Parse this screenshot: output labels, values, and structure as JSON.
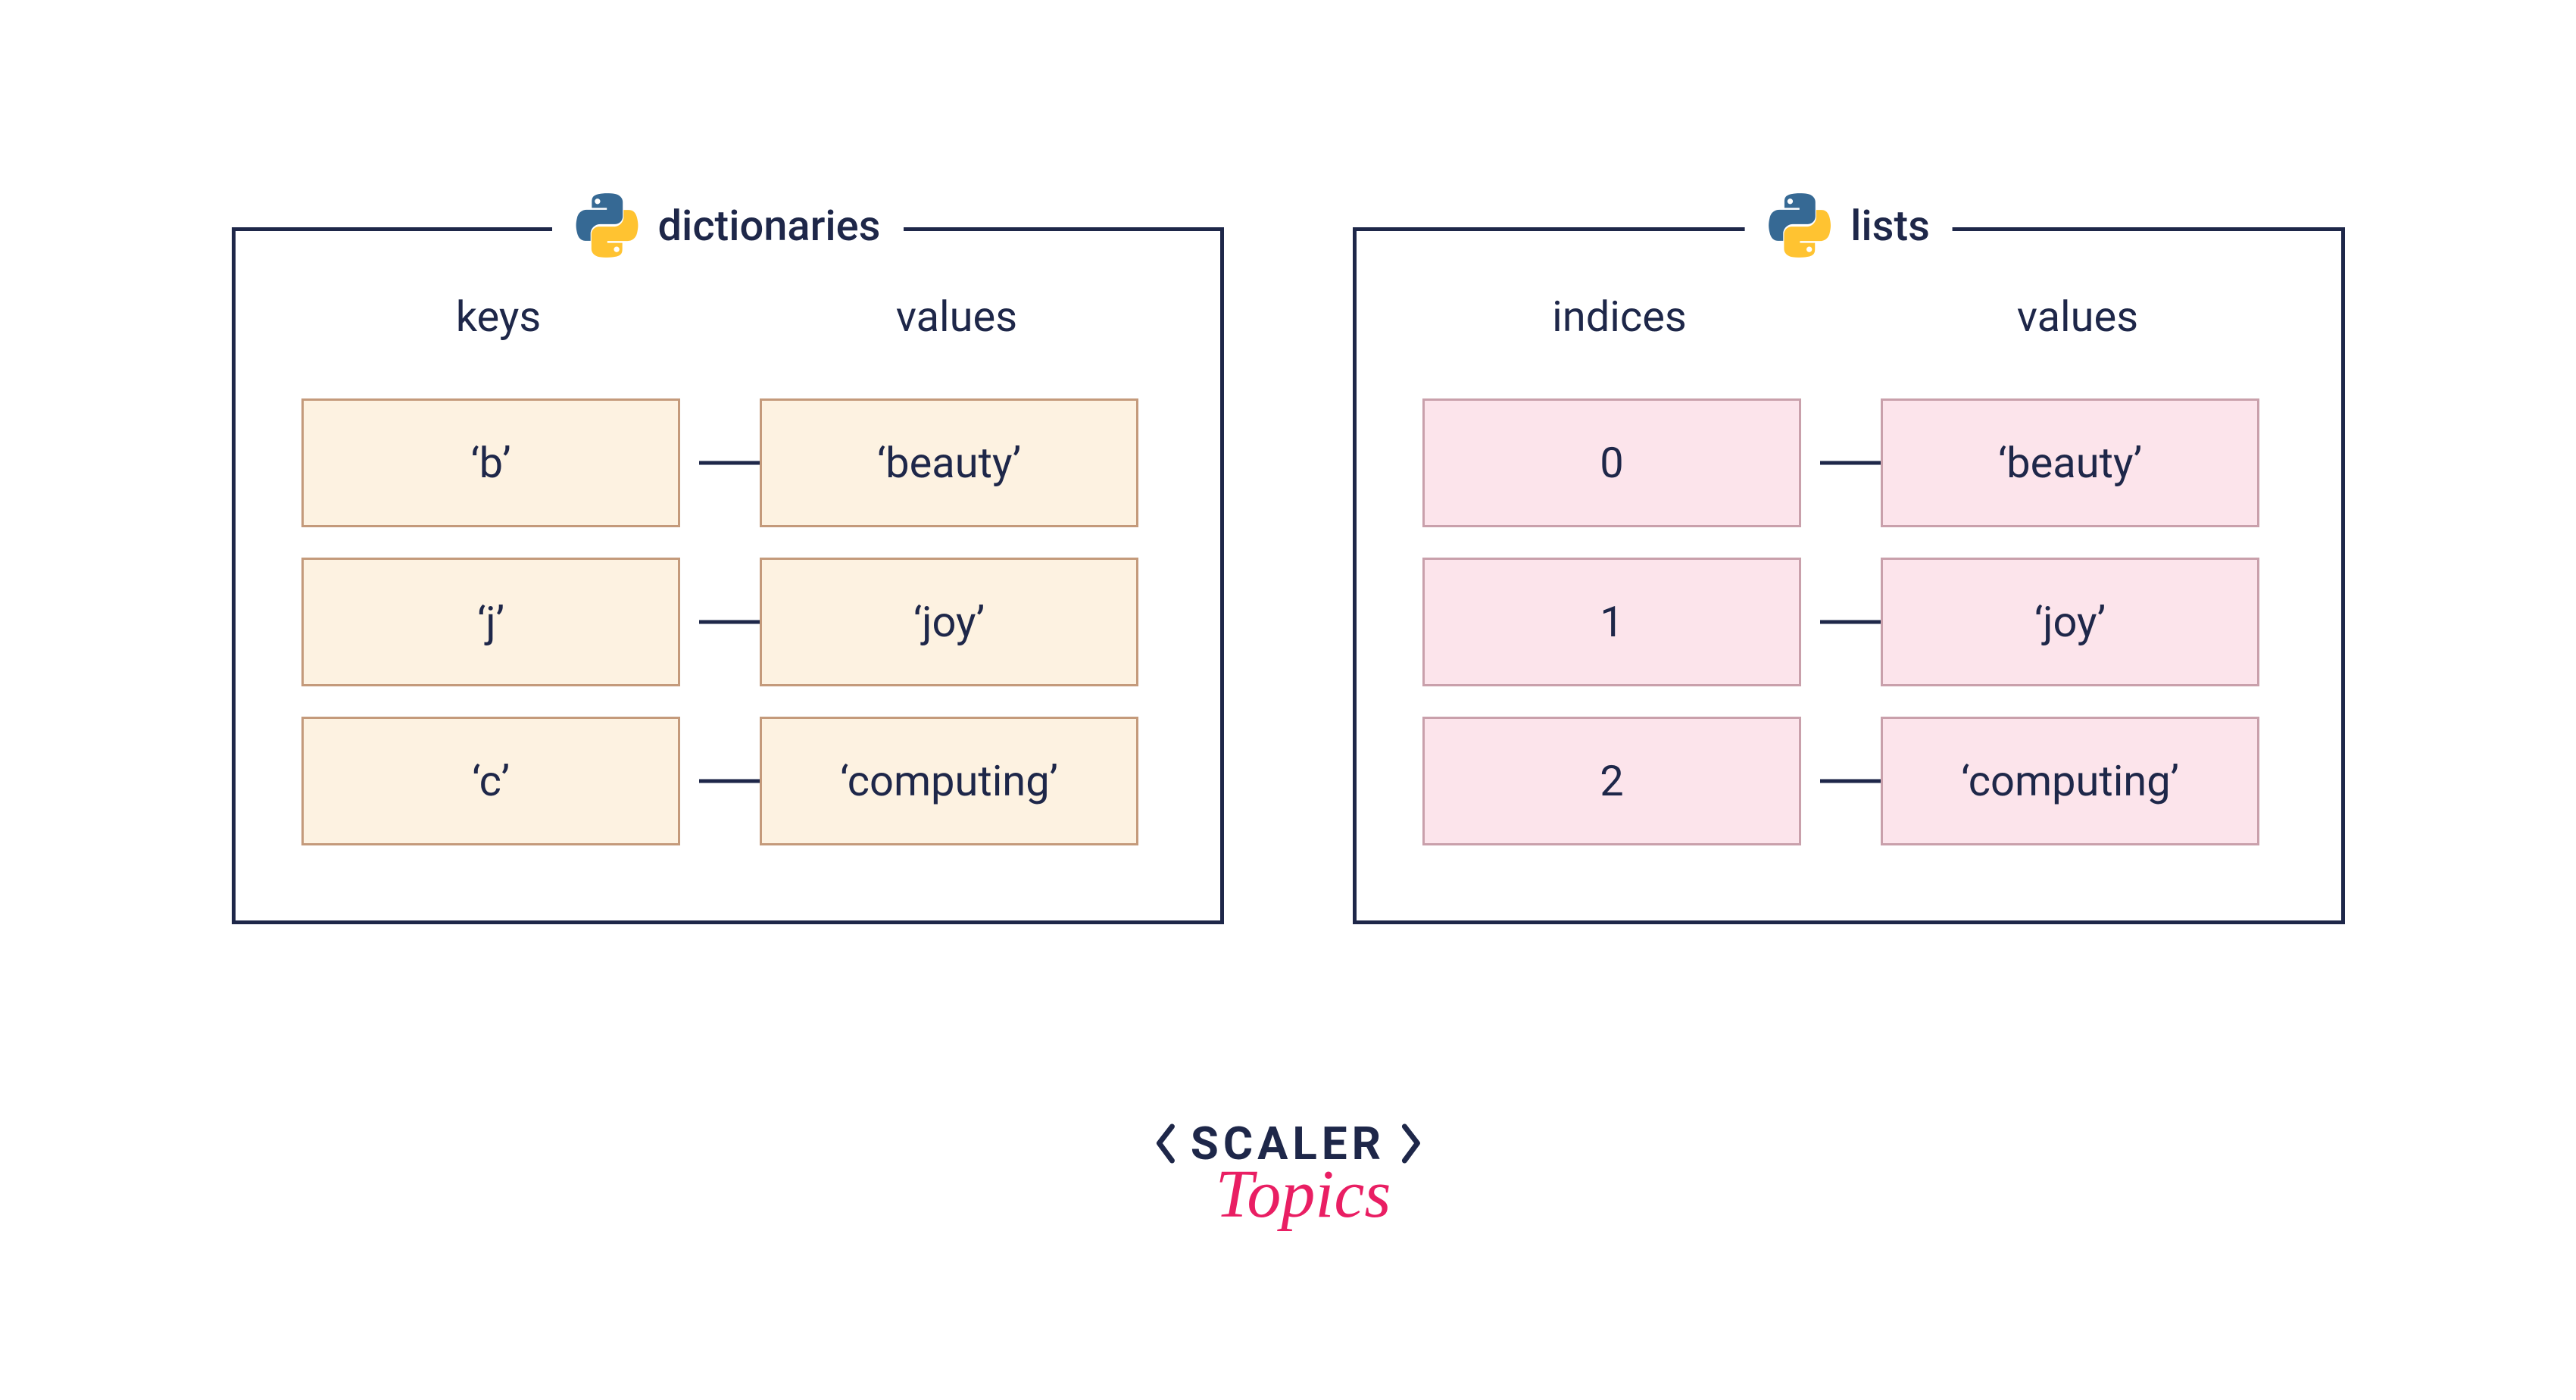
{
  "panels": [
    {
      "title": "dictionaries",
      "left_header": "keys",
      "right_header": "values",
      "color_class": "cell-orange",
      "rows": [
        {
          "left": "‘b’",
          "right": "‘beauty’"
        },
        {
          "left": "‘j’",
          "right": "‘joy’"
        },
        {
          "left": "‘c’",
          "right": "‘computing’"
        }
      ]
    },
    {
      "title": "lists",
      "left_header": "indices",
      "right_header": "values",
      "color_class": "cell-pink",
      "rows": [
        {
          "left": "0",
          "right": "‘beauty’"
        },
        {
          "left": "1",
          "right": "‘joy’"
        },
        {
          "left": "2",
          "right": "‘computing’"
        }
      ]
    }
  ],
  "logo": {
    "main": "SCALER",
    "sub": "Topics"
  }
}
